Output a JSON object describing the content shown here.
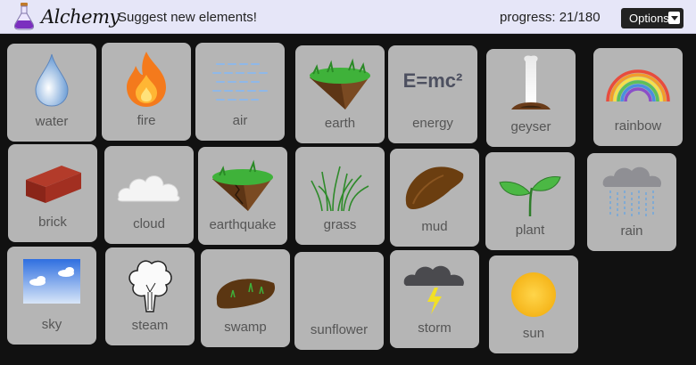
{
  "header": {
    "logo_text": "Alchemy",
    "suggest_link": "Suggest new elements!",
    "progress_text": "progress: 21/180",
    "options_label": "Options"
  },
  "progress": {
    "discovered": 21,
    "total": 180
  },
  "elements": [
    {
      "id": "water",
      "label": "water",
      "icon": "water-drop-icon"
    },
    {
      "id": "fire",
      "label": "fire",
      "icon": "flame-icon"
    },
    {
      "id": "air",
      "label": "air",
      "icon": "air-waves-icon"
    },
    {
      "id": "earth",
      "label": "earth",
      "icon": "earth-island-icon"
    },
    {
      "id": "energy",
      "label": "energy",
      "icon": "energy-formula-icon",
      "icon_text": "E=mc²"
    },
    {
      "id": "geyser",
      "label": "geyser",
      "icon": "geyser-icon"
    },
    {
      "id": "rainbow",
      "label": "rainbow",
      "icon": "rainbow-icon"
    },
    {
      "id": "brick",
      "label": "brick",
      "icon": "brick-icon"
    },
    {
      "id": "cloud",
      "label": "cloud",
      "icon": "cloud-icon"
    },
    {
      "id": "earthquake",
      "label": "earthquake",
      "icon": "earthquake-icon"
    },
    {
      "id": "grass",
      "label": "grass",
      "icon": "grass-icon"
    },
    {
      "id": "mud",
      "label": "mud",
      "icon": "mud-icon"
    },
    {
      "id": "plant",
      "label": "plant",
      "icon": "plant-icon"
    },
    {
      "id": "rain",
      "label": "rain",
      "icon": "rain-cloud-icon"
    },
    {
      "id": "sky",
      "label": "sky",
      "icon": "sky-icon"
    },
    {
      "id": "steam",
      "label": "steam",
      "icon": "steam-icon"
    },
    {
      "id": "swamp",
      "label": "swamp",
      "icon": "swamp-icon"
    },
    {
      "id": "sunflower",
      "label": "sunflower",
      "icon": "sunflower-icon"
    },
    {
      "id": "storm",
      "label": "storm",
      "icon": "storm-cloud-icon"
    },
    {
      "id": "sun",
      "label": "sun",
      "icon": "sun-icon"
    }
  ],
  "colors": {
    "topbar": "#e6e6f8",
    "board": "#111111",
    "tile": "#b5b5b5",
    "label": "#555555",
    "accent_purple": "#7b2fbf"
  }
}
